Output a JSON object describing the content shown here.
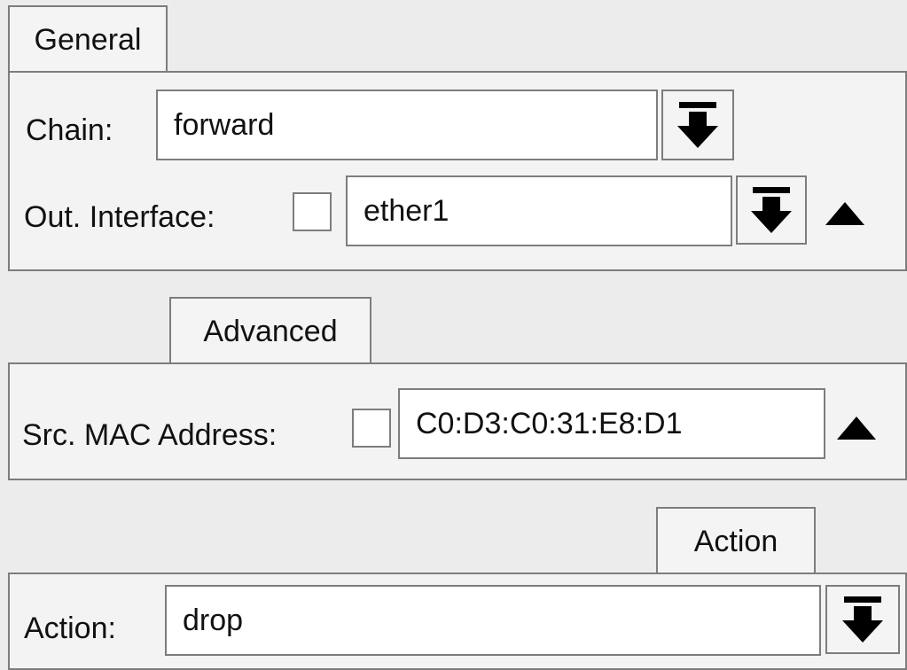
{
  "tabs": {
    "general": "General",
    "advanced": "Advanced",
    "action": "Action"
  },
  "general": {
    "chain_label": "Chain:",
    "chain_value": "forward",
    "out_interface_label": "Out. Interface:",
    "out_interface_value": "ether1"
  },
  "advanced": {
    "src_mac_label": "Src. MAC Address:",
    "src_mac_value": "C0:D3:C0:31:E8:D1"
  },
  "action": {
    "action_label": "Action:",
    "action_value": "drop"
  },
  "icons": {
    "dropdown": "dropdown-arrow-icon",
    "collapse": "triangle-up-icon"
  }
}
